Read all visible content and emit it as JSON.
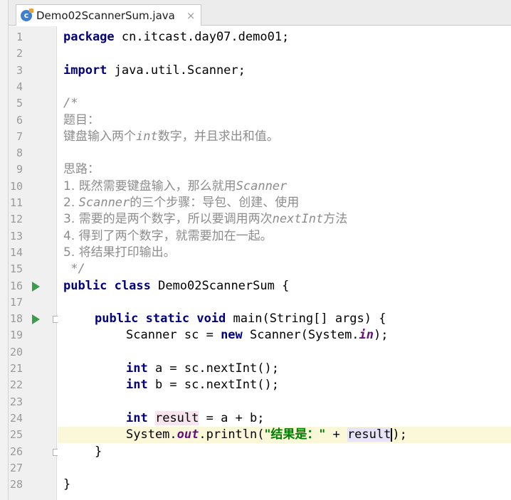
{
  "tab": {
    "icon_letter": "c",
    "title": "Demo02ScannerSum.java",
    "close": "×"
  },
  "line_numbers": [
    "1",
    "2",
    "3",
    "4",
    "5",
    "6",
    "7",
    "8",
    "9",
    "10",
    "11",
    "12",
    "13",
    "14",
    "15",
    "16",
    "17",
    "18",
    "19",
    "20",
    "21",
    "22",
    "23",
    "24",
    "25",
    "26",
    "27",
    "28"
  ],
  "code": {
    "l1": {
      "kw": "package",
      "rest": " cn.itcast.day07.demo01;"
    },
    "l3": {
      "kw": "import",
      "rest": " java.util.Scanner;"
    },
    "l5": "/*",
    "l6": "题目：",
    "l7": {
      "a": "键盘输入两个",
      "b": "int",
      "c": "数字，并且求出和值。"
    },
    "l9": "思路：",
    "l10": {
      "a": "1. 既然需要键盘输入，那么就用",
      "b": "Scanner"
    },
    "l11": {
      "a": "2. ",
      "b": "Scanner",
      "c": "的三个步骤：导包、创建、使用"
    },
    "l12": {
      "a": "3. 需要的是两个数字，所以要调用两次",
      "b": "nextInt",
      "c": "方法"
    },
    "l13": "4. 得到了两个数字，就需要加在一起。",
    "l14": "5. 将结果打印输出。",
    "l15": " */",
    "l16": {
      "kw1": "public",
      "kw2": "class",
      "rest": " Demo02ScannerSum {"
    },
    "l18": {
      "kw1": "public",
      "kw2": "static",
      "kw3": "void",
      "rest": " main(String[] args) {"
    },
    "l19": {
      "a": "Scanner sc = ",
      "kw": "new",
      "b": " Scanner(System.",
      "st": "in",
      "c": ");"
    },
    "l21": {
      "kw": "int",
      "rest": " a = sc.nextInt();"
    },
    "l22": {
      "kw": "int",
      "rest": " b = sc.nextInt();"
    },
    "l24": {
      "kw": "int",
      "var": "result",
      "rest": " = a + b;"
    },
    "l25": {
      "a": "System.",
      "st": "out",
      "b": ".println(",
      "str": "\"结果是：\"",
      "c": " + ",
      "var": "result",
      "d": ");"
    },
    "l26": "}",
    "l28": "}"
  },
  "colors": {
    "keyword": "#000080",
    "comment": "#8c8c8c",
    "string": "#008000",
    "static_field": "#660e7a",
    "current_line": "#fbf8da",
    "run_icon": "#3b9c4b"
  },
  "icons": [
    "java-class-icon",
    "close-icon",
    "run-icon",
    "fold-icon",
    "intention-bulb-icon"
  ]
}
